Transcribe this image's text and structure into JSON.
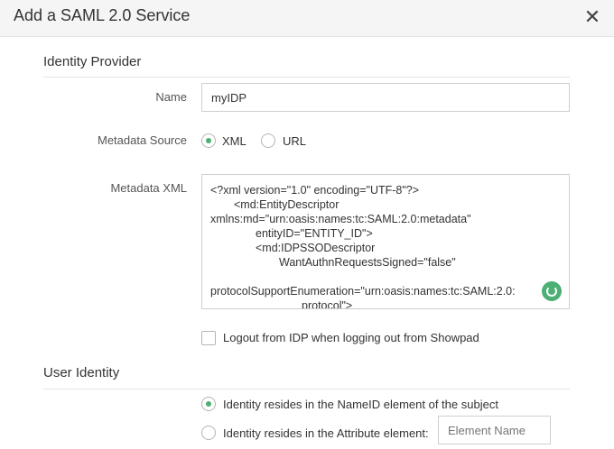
{
  "dialog": {
    "title": "Add a SAML 2.0 Service"
  },
  "identity_provider": {
    "section_title": "Identity Provider",
    "name_label": "Name",
    "name_value": "myIDP",
    "metadata_source_label": "Metadata Source",
    "source_options": [
      {
        "label": "XML",
        "selected": true
      },
      {
        "label": "URL",
        "selected": false
      }
    ],
    "metadata_xml_label": "Metadata XML",
    "metadata_xml_lines": [
      "<?xml version=\"1.0\" encoding=\"UTF-8\"?>",
      "<md:EntityDescriptor",
      "xmlns:md=\"urn:oasis:names:tc:SAML:2.0:metadata\"",
      "entityID=\"ENTITY_ID\">",
      "<md:IDPSSODescriptor",
      "WantAuthnRequestsSigned=\"false\"",
      "protocolSupportEnumeration=\"urn:oasis:names:tc:SAML:2.0:",
      "protocol\">"
    ],
    "logout_label": "Logout from IDP when logging out from Showpad",
    "logout_checked": false
  },
  "user_identity": {
    "section_title": "User Identity",
    "options": [
      {
        "label": "Identity resides in the NameID element of the subject",
        "selected": true
      },
      {
        "label": "Identity resides in the Attribute element:",
        "selected": false
      }
    ],
    "attribute_placeholder": "Element Name"
  },
  "colors": {
    "accent": "#4caf73",
    "header_bg": "#f5f5f5",
    "border": "#cfcfcf"
  },
  "icons": {
    "close": "close-icon",
    "loading": "spinner-icon"
  }
}
